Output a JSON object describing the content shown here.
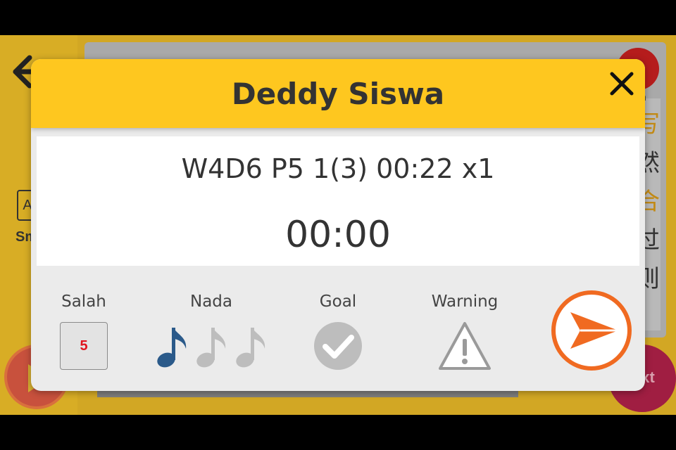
{
  "background_app": {
    "size_icon_letter": "A",
    "size_label": "Sm",
    "red_button_label": "h",
    "side_chars": [
      "写",
      "然",
      "合",
      "过",
      "则"
    ],
    "next_label": "ext"
  },
  "modal": {
    "title": "Deddy Siswa",
    "session_info": "W4D6 P5 1(3) 00:22 x1",
    "timer": "00:00",
    "stats": {
      "salah": {
        "label": "Salah",
        "value": "5"
      },
      "nada": {
        "label": "Nada",
        "active_notes": 1,
        "total_notes": 3
      },
      "goal": {
        "label": "Goal"
      },
      "warning": {
        "label": "Warning"
      }
    }
  },
  "colors": {
    "header": "#fec71f",
    "note_active": "#2b5a8a",
    "note_inactive": "#bdbdbd",
    "send_accent": "#f06a21",
    "salah_value": "#e0141e"
  },
  "icons": {
    "close": "close-icon",
    "send": "send-icon",
    "goal": "check-circle-icon",
    "warning": "warning-triangle-icon",
    "note": "music-note-icon",
    "back": "back-arrow-icon"
  }
}
